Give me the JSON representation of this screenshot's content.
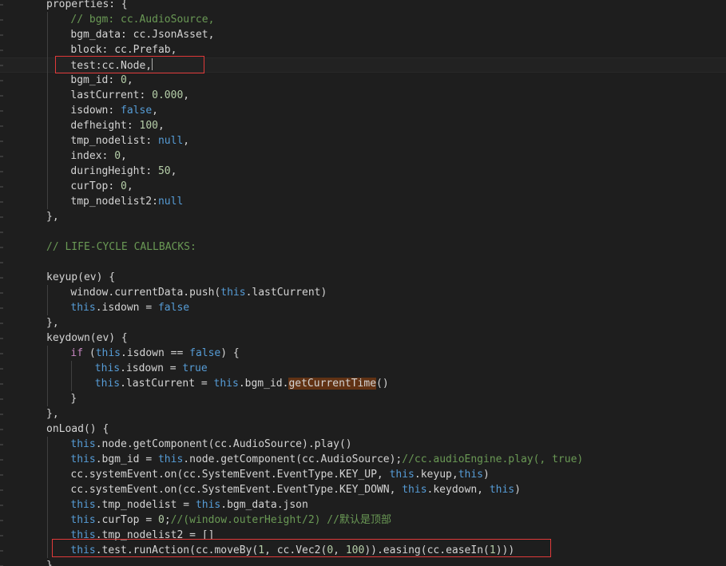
{
  "theme": {
    "background": "#1e1e1e",
    "default": "#d4d4d4",
    "comment": "#6a9955",
    "keyword": "#569cd6",
    "control": "#c586c0",
    "function": "#dcdcaa",
    "number": "#b5cea8",
    "variable": "#9cdcfe",
    "type": "#4ec9b0",
    "highlight_box": "#e03a3a"
  },
  "editor": {
    "lines": [
      {
        "tokens": [
          {
            "t": "properties",
            "c": "default"
          },
          {
            "t": ": {",
            "c": "default"
          }
        ]
      },
      {
        "tokens": [
          {
            "t": "// bgm: cc.AudioSource,",
            "c": "comment"
          }
        ]
      },
      {
        "tokens": [
          {
            "t": "bgm_data",
            "c": "default"
          },
          {
            "t": ": ",
            "c": "default"
          },
          {
            "t": "cc",
            "c": "default"
          },
          {
            "t": ".JsonAsset,",
            "c": "default"
          }
        ]
      },
      {
        "tokens": [
          {
            "t": "block",
            "c": "default"
          },
          {
            "t": ": ",
            "c": "default"
          },
          {
            "t": "cc",
            "c": "default"
          },
          {
            "t": ".Prefab,",
            "c": "default"
          }
        ]
      },
      {
        "tokens": [
          {
            "t": "test:cc.Node,",
            "c": "default"
          }
        ],
        "cursor": true,
        "current": true
      },
      {
        "tokens": [
          {
            "t": "bgm_id",
            "c": "default"
          },
          {
            "t": ": ",
            "c": "default"
          },
          {
            "t": "0",
            "c": "number"
          },
          {
            "t": ",",
            "c": "default"
          }
        ]
      },
      {
        "tokens": [
          {
            "t": "lastCurrent",
            "c": "default"
          },
          {
            "t": ": ",
            "c": "default"
          },
          {
            "t": "0.000",
            "c": "number"
          },
          {
            "t": ",",
            "c": "default"
          }
        ]
      },
      {
        "tokens": [
          {
            "t": "isdown",
            "c": "default"
          },
          {
            "t": ": ",
            "c": "default"
          },
          {
            "t": "false",
            "c": "keyword"
          },
          {
            "t": ",",
            "c": "default"
          }
        ]
      },
      {
        "tokens": [
          {
            "t": "defheight",
            "c": "default"
          },
          {
            "t": ": ",
            "c": "default"
          },
          {
            "t": "100",
            "c": "number"
          },
          {
            "t": ",",
            "c": "default"
          }
        ]
      },
      {
        "tokens": [
          {
            "t": "tmp_nodelist",
            "c": "default"
          },
          {
            "t": ": ",
            "c": "default"
          },
          {
            "t": "null",
            "c": "keyword"
          },
          {
            "t": ",",
            "c": "default"
          }
        ]
      },
      {
        "tokens": [
          {
            "t": "index",
            "c": "default"
          },
          {
            "t": ": ",
            "c": "default"
          },
          {
            "t": "0",
            "c": "number"
          },
          {
            "t": ",",
            "c": "default"
          }
        ]
      },
      {
        "tokens": [
          {
            "t": "duringHeight",
            "c": "default"
          },
          {
            "t": ": ",
            "c": "default"
          },
          {
            "t": "50",
            "c": "number"
          },
          {
            "t": ",",
            "c": "default"
          }
        ]
      },
      {
        "tokens": [
          {
            "t": "curTop",
            "c": "default"
          },
          {
            "t": ": ",
            "c": "default"
          },
          {
            "t": "0",
            "c": "number"
          },
          {
            "t": ",",
            "c": "default"
          }
        ]
      },
      {
        "tokens": [
          {
            "t": "tmp_nodelist2",
            "c": "default"
          },
          {
            "t": ":",
            "c": "default"
          },
          {
            "t": "null",
            "c": "keyword"
          }
        ]
      },
      {
        "tokens": [
          {
            "t": "},",
            "c": "default"
          }
        ]
      },
      {
        "tokens": []
      },
      {
        "tokens": [
          {
            "t": "// LIFE-CYCLE CALLBACKS:",
            "c": "comment"
          }
        ]
      },
      {
        "tokens": []
      },
      {
        "tokens": [
          {
            "t": "keyup",
            "c": "default"
          },
          {
            "t": "(",
            "c": "default"
          },
          {
            "t": "ev",
            "c": "default"
          },
          {
            "t": ") {",
            "c": "default"
          }
        ]
      },
      {
        "tokens": [
          {
            "t": "window",
            "c": "default"
          },
          {
            "t": ".",
            "c": "default"
          },
          {
            "t": "currentData",
            "c": "default"
          },
          {
            "t": ".",
            "c": "default"
          },
          {
            "t": "push",
            "c": "default"
          },
          {
            "t": "(",
            "c": "default"
          },
          {
            "t": "this",
            "c": "keyword"
          },
          {
            "t": ".",
            "c": "default"
          },
          {
            "t": "lastCurrent",
            "c": "default"
          },
          {
            "t": ")",
            "c": "default"
          }
        ]
      },
      {
        "tokens": [
          {
            "t": "this",
            "c": "keyword"
          },
          {
            "t": ".",
            "c": "default"
          },
          {
            "t": "isdown",
            "c": "default"
          },
          {
            "t": " = ",
            "c": "default"
          },
          {
            "t": "false",
            "c": "keyword"
          }
        ]
      },
      {
        "tokens": [
          {
            "t": "},",
            "c": "default"
          }
        ]
      },
      {
        "tokens": [
          {
            "t": "keydown",
            "c": "default"
          },
          {
            "t": "(",
            "c": "default"
          },
          {
            "t": "ev",
            "c": "default"
          },
          {
            "t": ") {",
            "c": "default"
          }
        ]
      },
      {
        "tokens": [
          {
            "t": "if",
            "c": "control"
          },
          {
            "t": " (",
            "c": "default"
          },
          {
            "t": "this",
            "c": "keyword"
          },
          {
            "t": ".",
            "c": "default"
          },
          {
            "t": "isdown",
            "c": "default"
          },
          {
            "t": " == ",
            "c": "default"
          },
          {
            "t": "false",
            "c": "keyword"
          },
          {
            "t": ") {",
            "c": "default"
          }
        ]
      },
      {
        "tokens": [
          {
            "t": "this",
            "c": "keyword"
          },
          {
            "t": ".",
            "c": "default"
          },
          {
            "t": "isdown",
            "c": "default"
          },
          {
            "t": " = ",
            "c": "default"
          },
          {
            "t": "true",
            "c": "keyword"
          }
        ]
      },
      {
        "tokens": [
          {
            "t": "this",
            "c": "keyword"
          },
          {
            "t": ".",
            "c": "default"
          },
          {
            "t": "lastCurrent",
            "c": "default"
          },
          {
            "t": " = ",
            "c": "default"
          },
          {
            "t": "this",
            "c": "keyword"
          },
          {
            "t": ".",
            "c": "default"
          },
          {
            "t": "bgm_id",
            "c": "default"
          },
          {
            "t": ".",
            "c": "default"
          },
          {
            "t": "getCurrentTime",
            "c": "default",
            "hl": true
          },
          {
            "t": "()",
            "c": "default"
          }
        ]
      },
      {
        "tokens": [
          {
            "t": "}",
            "c": "default"
          }
        ]
      },
      {
        "tokens": [
          {
            "t": "},",
            "c": "default"
          }
        ]
      },
      {
        "tokens": [
          {
            "t": "onLoad",
            "c": "default"
          },
          {
            "t": "() {",
            "c": "default"
          }
        ]
      },
      {
        "tokens": [
          {
            "t": "this",
            "c": "keyword"
          },
          {
            "t": ".",
            "c": "default"
          },
          {
            "t": "node",
            "c": "default"
          },
          {
            "t": ".",
            "c": "default"
          },
          {
            "t": "getComponent",
            "c": "default"
          },
          {
            "t": "(",
            "c": "default"
          },
          {
            "t": "cc",
            "c": "default"
          },
          {
            "t": ".AudioSource).",
            "c": "default"
          },
          {
            "t": "play",
            "c": "default"
          },
          {
            "t": "()",
            "c": "default"
          }
        ]
      },
      {
        "tokens": [
          {
            "t": "this",
            "c": "keyword"
          },
          {
            "t": ".",
            "c": "default"
          },
          {
            "t": "bgm_id",
            "c": "default"
          },
          {
            "t": " = ",
            "c": "default"
          },
          {
            "t": "this",
            "c": "keyword"
          },
          {
            "t": ".",
            "c": "default"
          },
          {
            "t": "node",
            "c": "default"
          },
          {
            "t": ".",
            "c": "default"
          },
          {
            "t": "getComponent",
            "c": "default"
          },
          {
            "t": "(",
            "c": "default"
          },
          {
            "t": "cc",
            "c": "default"
          },
          {
            "t": ".AudioSource);",
            "c": "default"
          },
          {
            "t": "//cc.audioEngine.play(, true)",
            "c": "comment"
          }
        ]
      },
      {
        "tokens": [
          {
            "t": "cc",
            "c": "default"
          },
          {
            "t": ".",
            "c": "default"
          },
          {
            "t": "systemEvent",
            "c": "default"
          },
          {
            "t": ".",
            "c": "default"
          },
          {
            "t": "on",
            "c": "default"
          },
          {
            "t": "(",
            "c": "default"
          },
          {
            "t": "cc",
            "c": "default"
          },
          {
            "t": ".SystemEvent.EventType.KEY_UP, ",
            "c": "default"
          },
          {
            "t": "this",
            "c": "keyword"
          },
          {
            "t": ".",
            "c": "default"
          },
          {
            "t": "keyup",
            "c": "default"
          },
          {
            "t": ",",
            "c": "default"
          },
          {
            "t": "this",
            "c": "keyword"
          },
          {
            "t": ")",
            "c": "default"
          }
        ]
      },
      {
        "tokens": [
          {
            "t": "cc",
            "c": "default"
          },
          {
            "t": ".",
            "c": "default"
          },
          {
            "t": "systemEvent",
            "c": "default"
          },
          {
            "t": ".",
            "c": "default"
          },
          {
            "t": "on",
            "c": "default"
          },
          {
            "t": "(",
            "c": "default"
          },
          {
            "t": "cc",
            "c": "default"
          },
          {
            "t": ".SystemEvent.EventType.KEY_DOWN, ",
            "c": "default"
          },
          {
            "t": "this",
            "c": "keyword"
          },
          {
            "t": ".",
            "c": "default"
          },
          {
            "t": "keydown",
            "c": "default"
          },
          {
            "t": ", ",
            "c": "default"
          },
          {
            "t": "this",
            "c": "keyword"
          },
          {
            "t": ")",
            "c": "default"
          }
        ]
      },
      {
        "tokens": [
          {
            "t": "this",
            "c": "keyword"
          },
          {
            "t": ".",
            "c": "default"
          },
          {
            "t": "tmp_nodelist",
            "c": "default"
          },
          {
            "t": " = ",
            "c": "default"
          },
          {
            "t": "this",
            "c": "keyword"
          },
          {
            "t": ".",
            "c": "default"
          },
          {
            "t": "bgm_data",
            "c": "default"
          },
          {
            "t": ".",
            "c": "default"
          },
          {
            "t": "json",
            "c": "default"
          }
        ]
      },
      {
        "tokens": [
          {
            "t": "this",
            "c": "keyword"
          },
          {
            "t": ".",
            "c": "default"
          },
          {
            "t": "curTop",
            "c": "default"
          },
          {
            "t": " = ",
            "c": "default"
          },
          {
            "t": "0",
            "c": "number"
          },
          {
            "t": ";",
            "c": "default"
          },
          {
            "t": "//(window.outerHeight/2) //默认是顶部",
            "c": "comment"
          }
        ]
      },
      {
        "tokens": [
          {
            "t": "this",
            "c": "keyword"
          },
          {
            "t": ".",
            "c": "default"
          },
          {
            "t": "tmp_nodelist2",
            "c": "default"
          },
          {
            "t": " = []",
            "c": "default"
          }
        ]
      },
      {
        "tokens": [
          {
            "t": "this",
            "c": "keyword"
          },
          {
            "t": ".",
            "c": "default"
          },
          {
            "t": "test",
            "c": "default"
          },
          {
            "t": ".",
            "c": "default"
          },
          {
            "t": "runAction",
            "c": "default"
          },
          {
            "t": "(",
            "c": "default"
          },
          {
            "t": "cc",
            "c": "default"
          },
          {
            "t": ".",
            "c": "default"
          },
          {
            "t": "moveBy",
            "c": "default"
          },
          {
            "t": "(",
            "c": "default"
          },
          {
            "t": "1",
            "c": "number"
          },
          {
            "t": ", ",
            "c": "default"
          },
          {
            "t": "cc",
            "c": "default"
          },
          {
            "t": ".",
            "c": "default"
          },
          {
            "t": "Vec2",
            "c": "default"
          },
          {
            "t": "(",
            "c": "default"
          },
          {
            "t": "0",
            "c": "number"
          },
          {
            "t": ", ",
            "c": "default"
          },
          {
            "t": "100",
            "c": "number"
          },
          {
            "t": ")).",
            "c": "default"
          },
          {
            "t": "easing",
            "c": "default"
          },
          {
            "t": "(",
            "c": "default"
          },
          {
            "t": "cc",
            "c": "default"
          },
          {
            "t": ".",
            "c": "default"
          },
          {
            "t": "easeIn",
            "c": "default"
          },
          {
            "t": "(",
            "c": "default"
          },
          {
            "t": "1",
            "c": "number"
          },
          {
            "t": ")))",
            "c": "default"
          }
        ]
      },
      {
        "tokens": [
          {
            "t": "},",
            "c": "default"
          }
        ]
      }
    ]
  }
}
